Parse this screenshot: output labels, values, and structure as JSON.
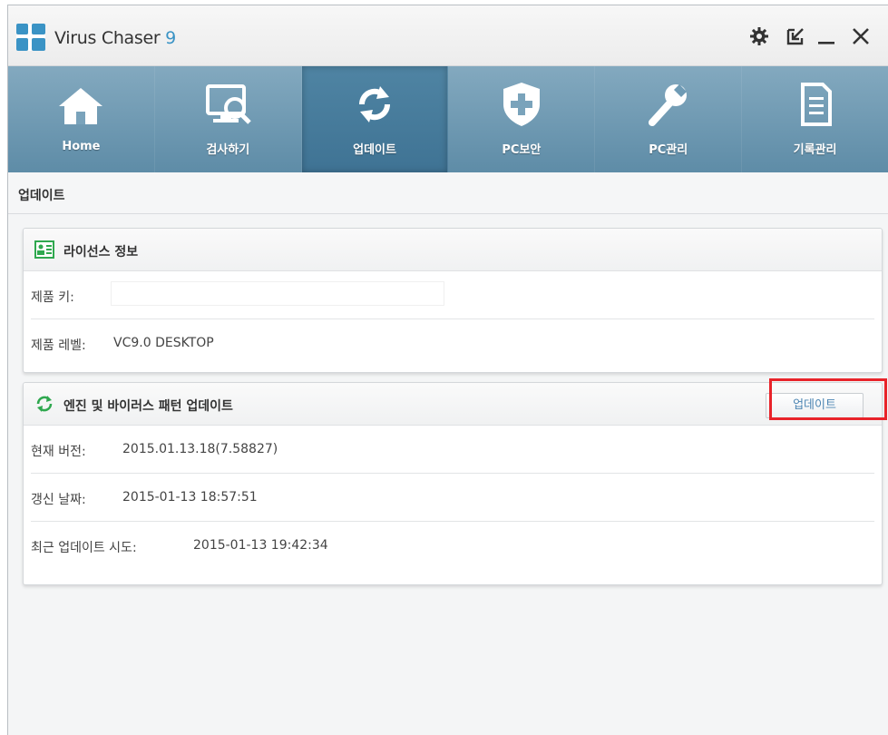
{
  "app": {
    "title": "Virus Chaser",
    "version": "9"
  },
  "titlebar": {
    "buttons": [
      "gear-icon",
      "minimize-to-tray-icon",
      "minimize-icon",
      "close-icon"
    ]
  },
  "nav": {
    "items": [
      {
        "label": "Home",
        "icon": "home-icon",
        "active": false
      },
      {
        "label": "검사하기",
        "icon": "scan-icon",
        "active": false
      },
      {
        "label": "업데이트",
        "icon": "refresh-icon",
        "active": true
      },
      {
        "label": "PC보안",
        "icon": "shield-icon",
        "active": false
      },
      {
        "label": "PC관리",
        "icon": "wrench-icon",
        "active": false
      },
      {
        "label": "기록관리",
        "icon": "document-icon",
        "active": false
      }
    ]
  },
  "page": {
    "title": "업데이트"
  },
  "license": {
    "title": "라이선스 정보",
    "product_key_label": "제품 키:",
    "product_key_value": "",
    "product_level_label": "제품 레벨:",
    "product_level_value": "VC9.0 DESKTOP"
  },
  "engine": {
    "title": "엔진 및 바이러스 패턴 업데이트",
    "update_button": "업데이트",
    "current_version_label": "현재 버전:",
    "current_version_value": "2015.01.13.18(7.58827)",
    "renewal_date_label": "갱신 날짜:",
    "renewal_date_value": "2015-01-13 18:57:51",
    "last_attempt_label": "최근 업데이트 시도:",
    "last_attempt_value": "2015-01-13 19:42:34"
  },
  "colors": {
    "nav_bg": "#6f9bb5",
    "nav_active": "#4a7e9e",
    "accent_blue": "#3a93c5",
    "highlight_red": "#e8232a",
    "refresh_green": "#2fa84f"
  }
}
